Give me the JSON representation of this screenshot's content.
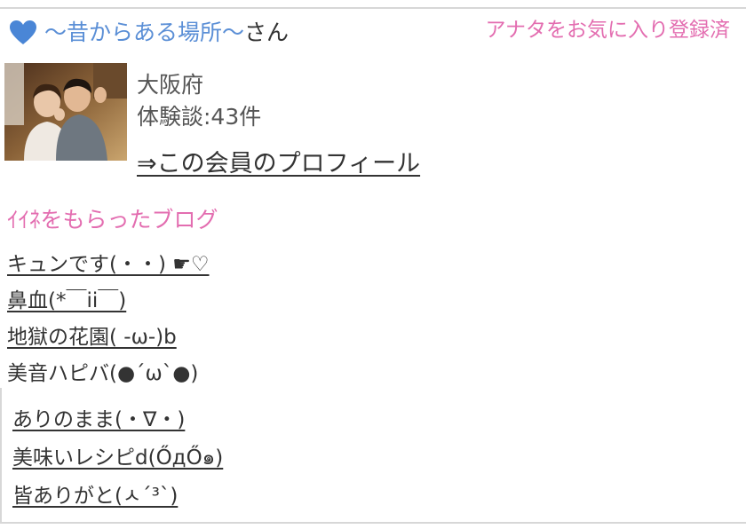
{
  "header": {
    "heart_icon": "heart-icon",
    "heart_color": "#4a86d6",
    "member_name": "〜昔からある場所〜",
    "name_suffix": "さん",
    "favorite_status": "アナタをお気に入り登録済"
  },
  "profile": {
    "avatar_alt": "member-photo",
    "prefecture": "大阪府",
    "experience_count": "体験談:43件",
    "profile_link": "⇒この会員のプロフィール"
  },
  "liked_blogs": {
    "title": "ｲｲﾈをもらったブログ",
    "items": [
      "キュンです(・・) ☛♡",
      "鼻血(*￣ii￣)",
      "地獄の花園( -ω-)b",
      "美音ハピバ(●´ω`●)"
    ],
    "items_more": [
      "ありのまま(・∇・)",
      "美味いレシピd(ŐдŐ๑)",
      "皆ありがと(ㅅ´³`)"
    ]
  },
  "colors": {
    "accent_pink": "#e36db0",
    "name_blue": "#5b8fd6",
    "text": "#333333"
  }
}
